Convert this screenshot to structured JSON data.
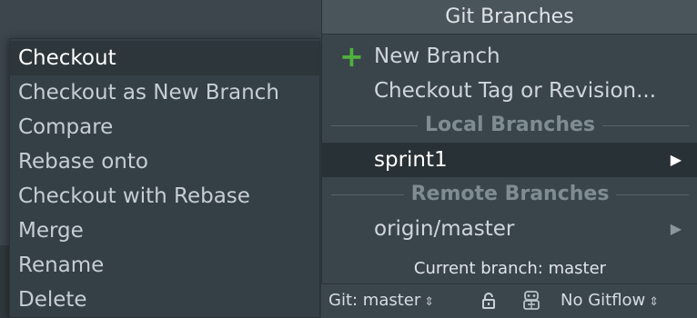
{
  "submenu": {
    "items": [
      {
        "label": "Checkout",
        "selected": true
      },
      {
        "label": "Checkout as New Branch"
      },
      {
        "label": "Compare"
      },
      {
        "label": "Rebase onto"
      },
      {
        "label": "Checkout with Rebase"
      },
      {
        "label": "Merge"
      },
      {
        "label": "Rename"
      },
      {
        "label": "Delete"
      }
    ]
  },
  "popup": {
    "title": "Git Branches",
    "actions": {
      "new_branch": "New Branch",
      "checkout_tag": "Checkout Tag or Revision..."
    },
    "local_header": "Local Branches",
    "local_branches": [
      "sprint1"
    ],
    "remote_header": "Remote Branches",
    "remote_branches": [
      "origin/master"
    ],
    "current_branch": "Current branch: master"
  },
  "statusbar": {
    "git_label": "Git: master",
    "gitflow_label": "No Gitflow",
    "updown_glyph": "⇕"
  },
  "icons": {
    "plus": "+",
    "arrow": "▶"
  },
  "colors": {
    "accent_green": "#4fb03e",
    "selection": "#283136"
  }
}
